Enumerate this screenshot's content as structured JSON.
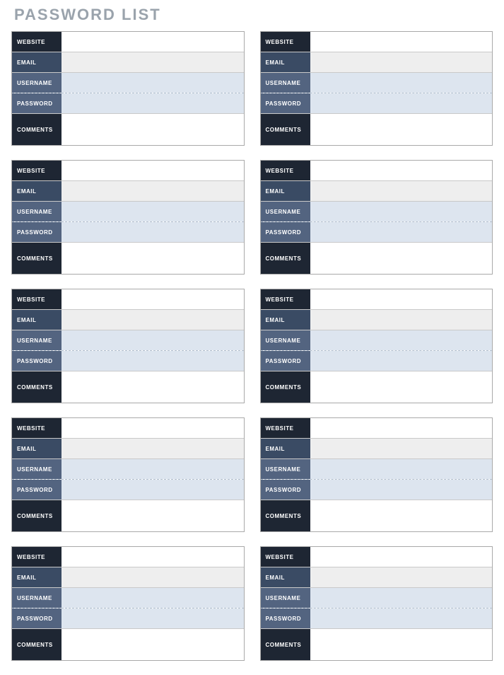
{
  "title": "PASSWORD LIST",
  "fieldLabels": {
    "website": "WEBSITE",
    "email": "EMAIL",
    "username": "USERNAME",
    "password": "PASSWORD",
    "comments": "COMMENTS"
  },
  "entries": [
    {
      "website": "",
      "email": "",
      "username": "",
      "password": "",
      "comments": ""
    },
    {
      "website": "",
      "email": "",
      "username": "",
      "password": "",
      "comments": ""
    },
    {
      "website": "",
      "email": "",
      "username": "",
      "password": "",
      "comments": ""
    },
    {
      "website": "",
      "email": "",
      "username": "",
      "password": "",
      "comments": ""
    },
    {
      "website": "",
      "email": "",
      "username": "",
      "password": "",
      "comments": ""
    },
    {
      "website": "",
      "email": "",
      "username": "",
      "password": "",
      "comments": ""
    },
    {
      "website": "",
      "email": "",
      "username": "",
      "password": "",
      "comments": ""
    },
    {
      "website": "",
      "email": "",
      "username": "",
      "password": "",
      "comments": ""
    },
    {
      "website": "",
      "email": "",
      "username": "",
      "password": "",
      "comments": ""
    },
    {
      "website": "",
      "email": "",
      "username": "",
      "password": "",
      "comments": ""
    }
  ]
}
